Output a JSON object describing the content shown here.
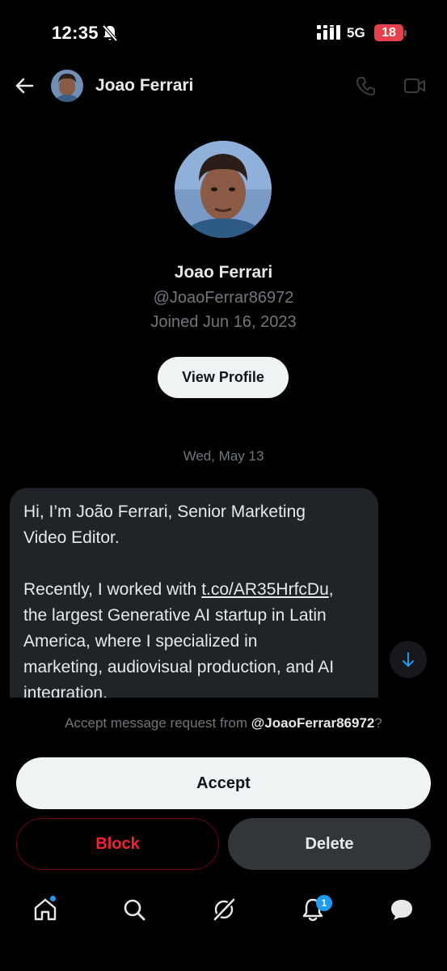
{
  "status_bar": {
    "time": "12:35",
    "network": "5G",
    "battery": "18",
    "icons": [
      "bell-off-icon",
      "signal-icon"
    ]
  },
  "header": {
    "name": "Joao Ferrari",
    "icons": [
      "back-arrow-icon",
      "phone-icon",
      "video-icon"
    ]
  },
  "profile": {
    "name": "Joao Ferrari",
    "handle": "@JoaoFerrar86972",
    "joined": "Joined Jun 16, 2023",
    "view_profile_label": "View Profile"
  },
  "conversation": {
    "date": "Wed, May 13",
    "message": {
      "p1_line1": "Hi, I’m João Ferrari, Senior Marketing",
      "p1_line2": "Video Editor.",
      "p2_prefix": "Recently, I worked with ",
      "p2_link": "t.co/AR35HrfcDu",
      "p2_suffix": ",",
      "p2_line2": "the largest Generative AI startup in Latin",
      "p2_line3": "America, where I specialized in",
      "p2_line4": "marketing, audiovisual production, and AI",
      "p2_line5": "integration."
    }
  },
  "request": {
    "prompt_prefix": "Accept message request from ",
    "prompt_handle": "@JoaoFerrar86972",
    "prompt_suffix": "?",
    "accept_label": "Accept",
    "block_label": "Block",
    "delete_label": "Delete"
  },
  "bottom_nav": {
    "items": [
      "home-icon",
      "search-icon",
      "grok-icon",
      "notifications-icon",
      "messages-icon"
    ],
    "notifications_count": "1"
  },
  "colors": {
    "background": "#000000",
    "accent": "#1d9bf0",
    "danger": "#f4212e",
    "muted_text": "#71767b",
    "bubble": "#202327"
  }
}
